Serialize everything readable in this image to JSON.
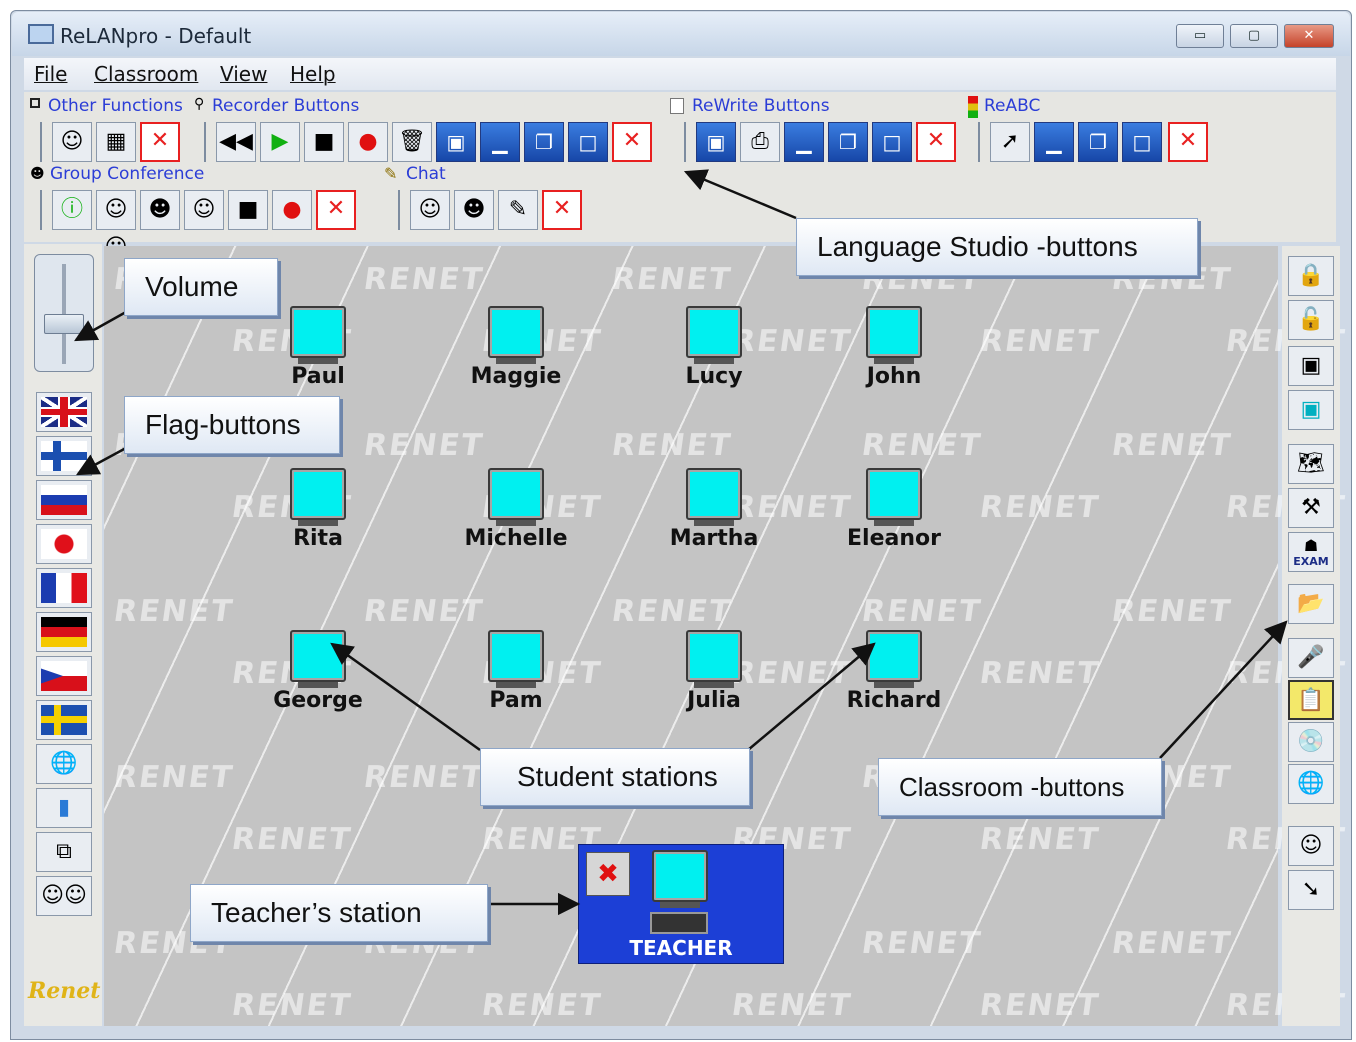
{
  "window": {
    "title": "ReLANpro - Default"
  },
  "window_controls": {
    "minimize": "▭",
    "maximize": "▢",
    "close": "✕"
  },
  "menu": {
    "items": [
      "File",
      "Classroom",
      "View",
      "Help"
    ]
  },
  "toolbar_groups": {
    "other_functions": "Other Functions",
    "recorder_buttons": "Recorder Buttons",
    "rewrite_buttons": "ReWrite Buttons",
    "reabc": "ReABC",
    "group_conference": "Group Conference",
    "chat": "Chat"
  },
  "watermark": "RENET",
  "students": {
    "row1": [
      "Paul",
      "Maggie",
      "Lucy",
      "John"
    ],
    "row2": [
      "Rita",
      "Michelle",
      "Martha",
      "Eleanor"
    ],
    "row3": [
      "George",
      "Pam",
      "Julia",
      "Richard"
    ]
  },
  "teacher": {
    "label": "TEACHER"
  },
  "logo": "Renet",
  "callouts": {
    "language_studio": "Language Studio -buttons",
    "volume": "Volume",
    "flag_buttons": "Flag-buttons",
    "student_stations": "Student stations",
    "classroom_buttons": "Classroom -buttons",
    "teacher_station": "Teacher’s station"
  },
  "right_buttons": {
    "exam_label": "EXAM"
  },
  "colors": {
    "monitor": "#00f0f0",
    "teacher_bg": "#1c3fd6",
    "toolbar_label": "#2b3dd6"
  }
}
